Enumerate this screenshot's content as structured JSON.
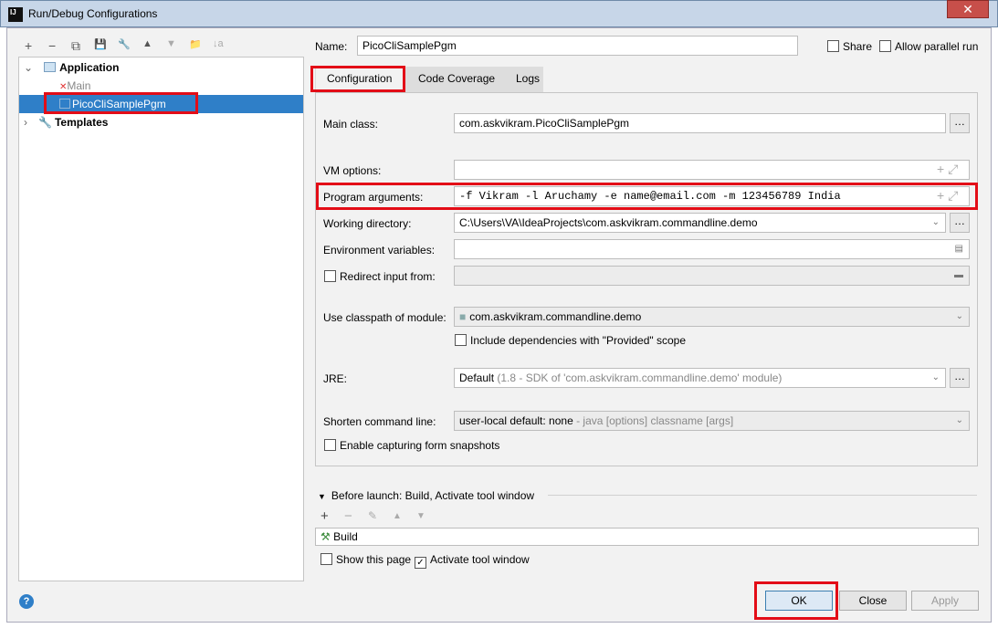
{
  "window": {
    "title": "Run/Debug Configurations",
    "close": "✕"
  },
  "toolbar": [
    "+",
    "−",
    "⧉",
    "💾",
    "🔧",
    "▲",
    "▼",
    "📁",
    "↓a"
  ],
  "tree": {
    "application": "Application",
    "main": "Main",
    "selected": "PicoCliSamplePgm",
    "templates": "Templates"
  },
  "name": {
    "label": "Name:",
    "value": "PicoCliSamplePgm"
  },
  "share": "Share",
  "parallel": "Allow parallel run",
  "tabs": [
    "Configuration",
    "Code Coverage",
    "Logs"
  ],
  "form": {
    "main_class_label": "Main class:",
    "main_class": "com.askvikram.PicoCliSamplePgm",
    "vm_label": "VM options:",
    "vm": "",
    "args_label": "Program arguments:",
    "args": "-f Vikram -l Aruchamy -e name@email.com -m 123456789 India",
    "wd_label": "Working directory:",
    "wd": "C:\\Users\\VA\\IdeaProjects\\com.askvikram.commandline.demo",
    "env_label": "Environment variables:",
    "redirect_label": "Redirect input from:",
    "module_label": "Use classpath of module:",
    "module": "com.askvikram.commandline.demo",
    "include_deps": "Include dependencies with \"Provided\" scope",
    "jre_label": "JRE:",
    "jre": "Default",
    "jre_hint": "(1.8 - SDK of 'com.askvikram.commandline.demo' module)",
    "shorten_label": "Shorten command line:",
    "shorten": "user-local default: none",
    "shorten_hint": "- java [options] classname [args]",
    "snapshots": "Enable capturing form snapshots"
  },
  "before_launch": {
    "title": "Before launch: Build, Activate tool window",
    "item": "Build",
    "show_page": "Show this page",
    "activate": "Activate tool window"
  },
  "buttons": {
    "ok": "OK",
    "close": "Close",
    "apply": "Apply",
    "help": "?"
  }
}
